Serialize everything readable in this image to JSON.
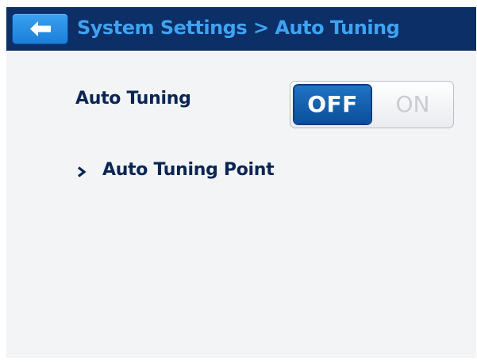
{
  "header": {
    "back_icon": "back-arrow-icon",
    "title": "System Settings > Auto Tuning"
  },
  "settings": {
    "auto_tuning": {
      "label": "Auto Tuning",
      "toggle": {
        "off_label": "OFF",
        "on_label": "ON",
        "selected": "OFF"
      }
    },
    "auto_tuning_point": {
      "chevron_icon": "chevron-right-icon",
      "label": "Auto Tuning Point"
    }
  },
  "colors": {
    "header_bg": "#0b2f66",
    "title_text": "#3fa2f2",
    "body_bg": "#f3f4f6",
    "label_text": "#0a2555",
    "toggle_active": "#1f73c4"
  }
}
